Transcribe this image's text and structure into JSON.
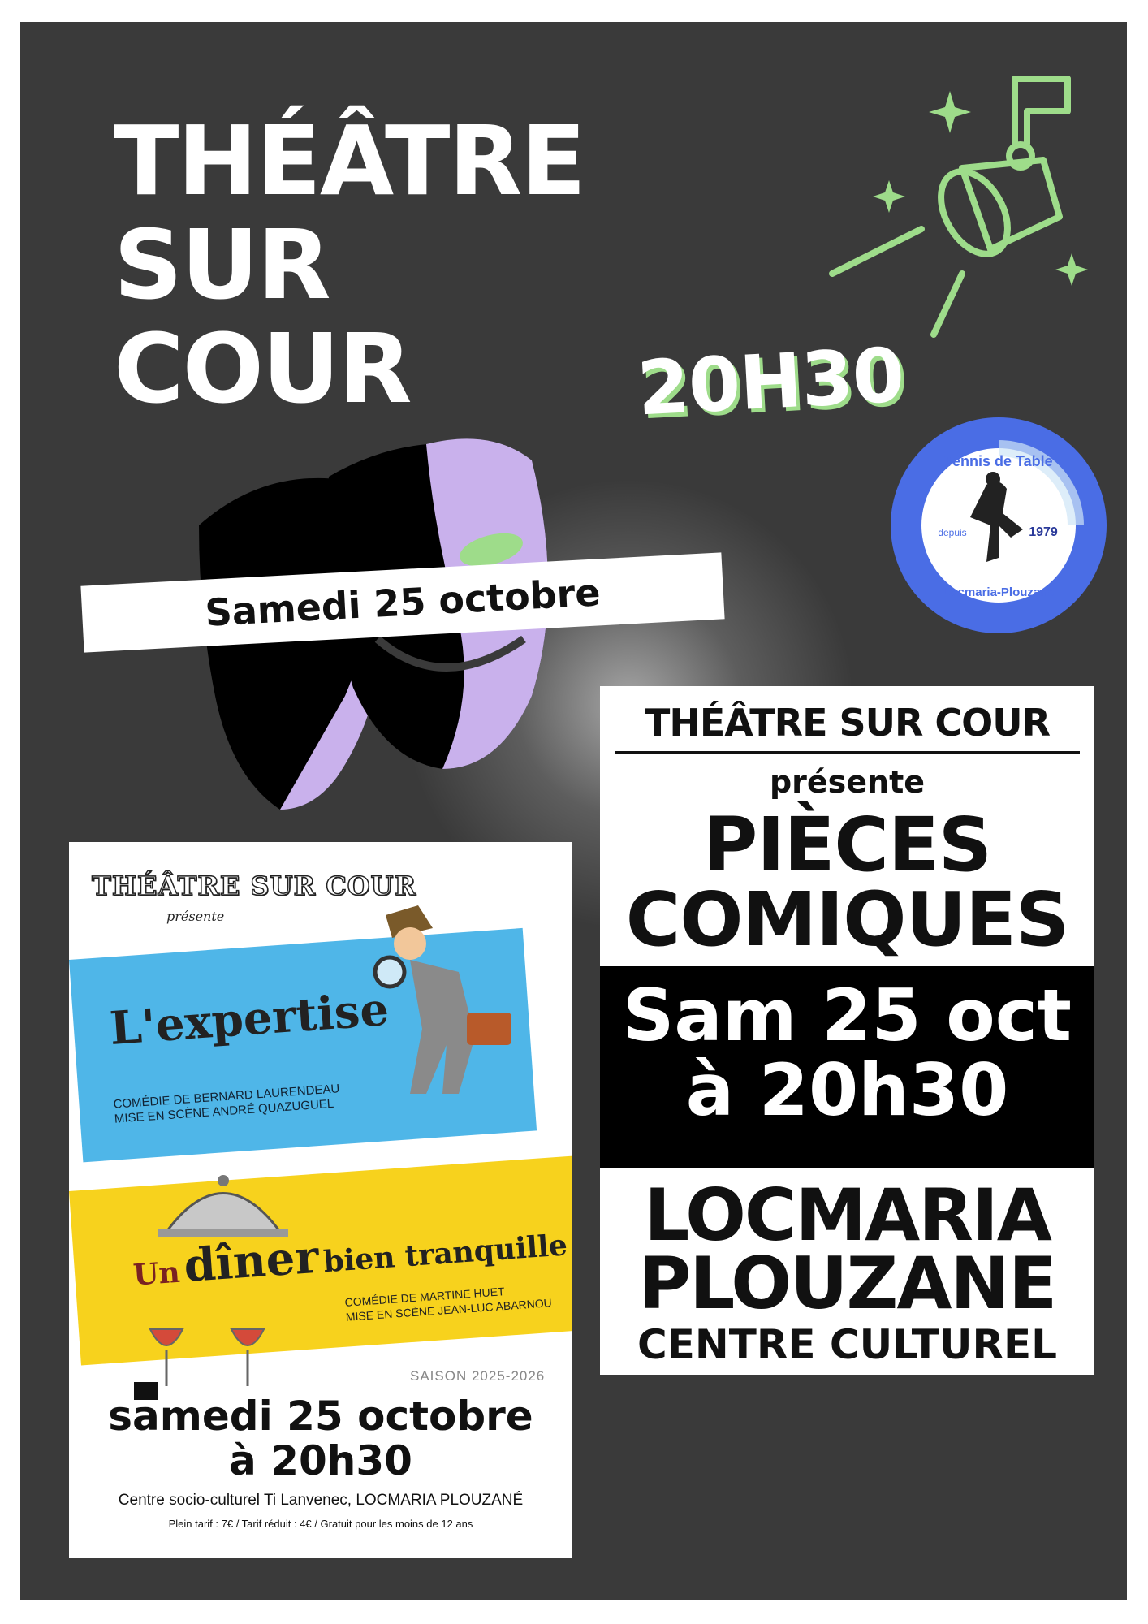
{
  "header": {
    "title_lines": [
      "THÉÂTRE",
      "SUR",
      "COUR"
    ],
    "time": "20H30",
    "date_banner": "Samedi 25 octobre"
  },
  "club_logo": {
    "top_text": "Tennis de Table",
    "left_text": "depuis",
    "year": "1979",
    "bottom_text": "Locmaria-Plouzané"
  },
  "mini_poster": {
    "troupe": "THÉÂTRE SUR COUR",
    "presente": "présente",
    "play1": {
      "title": "L'expertise",
      "credit_line1": "COMÉDIE DE BERNARD LAURENDEAU",
      "credit_line2": "MISE EN SCÈNE ANDRÉ QUAZUGUEL"
    },
    "play2": {
      "title_a": "Un",
      "title_b": "dîner",
      "title_c": "bien tranquille",
      "credit_line1": "COMÉDIE DE MARTINE HUET",
      "credit_line2": "MISE EN SCÈNE JEAN-LUC ABARNOU"
    },
    "season": "SAISON 2025-2026",
    "date_line1": "samedi 25 octobre",
    "date_line2": "à 20h30",
    "venue": "Centre socio-culturel Ti Lanvenec, LOCMARIA PLOUZANÉ",
    "prices": "Plein tarif : 7€ / Tarif réduit : 4€ / Gratuit pour les moins de 12 ans"
  },
  "flyer": {
    "heading": "THÉÂTRE SUR COUR",
    "presente": "présente",
    "pieces_line1": "PIÈCES",
    "pieces_line2": "COMIQUES",
    "date_line1": "Sam 25 oct",
    "date_line2": "à 20h30",
    "town_line1": "LOCMARIA",
    "town_line2": "PLOUZANE",
    "venue": "CENTRE CULTUREL"
  },
  "colors": {
    "background": "#3a3a3a",
    "accent_green": "#9edc8a",
    "mask_purple": "#c9b1ec",
    "logo_blue": "#4a6de5",
    "band_blue": "#4fb6e8",
    "band_yellow": "#f7d21d"
  },
  "icons": [
    "spotlight-icon",
    "theatre-masks-icon",
    "sparkle-icon",
    "cloche-icon",
    "wine-glass-icon",
    "magnifier-icon",
    "briefcase-icon"
  ]
}
